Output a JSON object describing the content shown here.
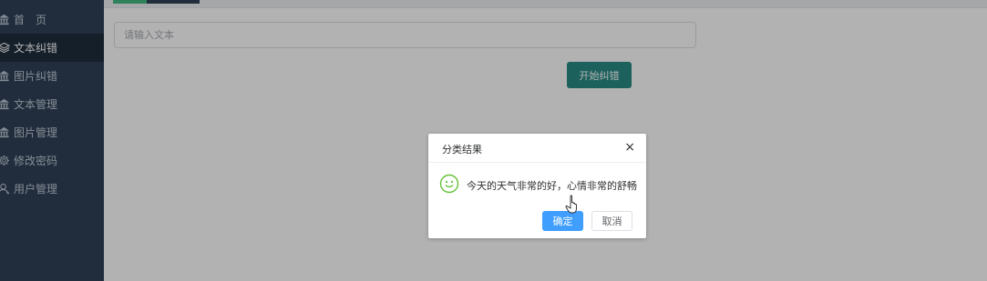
{
  "sidebar": {
    "items": [
      {
        "label": "首　页",
        "icon": "bank-icon",
        "active": false
      },
      {
        "label": "文本纠错",
        "icon": "layers-icon",
        "active": true
      },
      {
        "label": "图片纠错",
        "icon": "bank-icon",
        "active": false
      },
      {
        "label": "文本管理",
        "icon": "bank-icon",
        "active": false
      },
      {
        "label": "图片管理",
        "icon": "bank-icon",
        "active": false
      },
      {
        "label": "修改密码",
        "icon": "gear-icon",
        "active": false
      },
      {
        "label": "用户管理",
        "icon": "user-icon",
        "active": false
      }
    ]
  },
  "main": {
    "text_input": {
      "placeholder": "请输入文本",
      "value": ""
    },
    "start_button": "开始纠错"
  },
  "dialog": {
    "title": "分类结果",
    "close_symbol": "×",
    "message": "今天的天气非常的好，心情非常的舒畅",
    "icon": "smile-icon",
    "ok_label": "确定",
    "cancel_label": "取消"
  },
  "colors": {
    "sidebar_bg": "#304156",
    "sidebar_active_bg": "#1f2d3d",
    "primary_button": "#409eff",
    "start_button": "#2a8c86",
    "success_icon": "#67c23a"
  }
}
